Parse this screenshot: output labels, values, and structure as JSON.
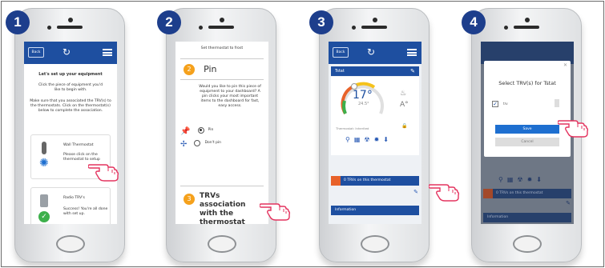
{
  "steps": [
    "1",
    "2",
    "3",
    "4"
  ],
  "screen1": {
    "back_label": "Back",
    "heading": "Let's set up your equipment",
    "intro": "Click the piece of equipment you'd like to begin with.",
    "desc": "Make sure that you associated the TRV(s) to the thermostats. Click on the thermostat(s) below to complete the association.",
    "card1_title": "Wall Thermostat",
    "card1_text": "Please click on the thermostat to setup",
    "card2_title": "Radio TRV's",
    "card2_text": "Success! You're all done with set up."
  },
  "screen2": {
    "top_text": "Set thermostat to frost",
    "pin_num": "2",
    "pin_title": "Pin",
    "pin_desc": "Would you like to pin this piece of equipment to your dashboard? A pin clicks your most important items to the dashboard for fast, easy access.",
    "opt_pin": "Pin",
    "opt_nopin": "Don't pin",
    "trv_num": "3",
    "trv_title": "TRVs association with the thermostat"
  },
  "screen3": {
    "back_label": "Back",
    "zone": "Tstat",
    "temp": "17°",
    "setpoint": "24.5°",
    "hvac": "Thermostat: Inherited",
    "trv_banner": "0 TRVs on this thermostat",
    "info": "Information"
  },
  "screen4": {
    "dialog_title": "Select TRV(s) for Tstat",
    "trv_item": "trv",
    "save": "Save",
    "cancel": "Cancel",
    "trv_banner": "0 TRVs on this thermostat",
    "info": "Information"
  },
  "colors": {
    "brand_blue": "#1e4fa0",
    "badge": "#1d3e8c",
    "orange": "#f5a11c",
    "red_orange": "#e8622a"
  }
}
